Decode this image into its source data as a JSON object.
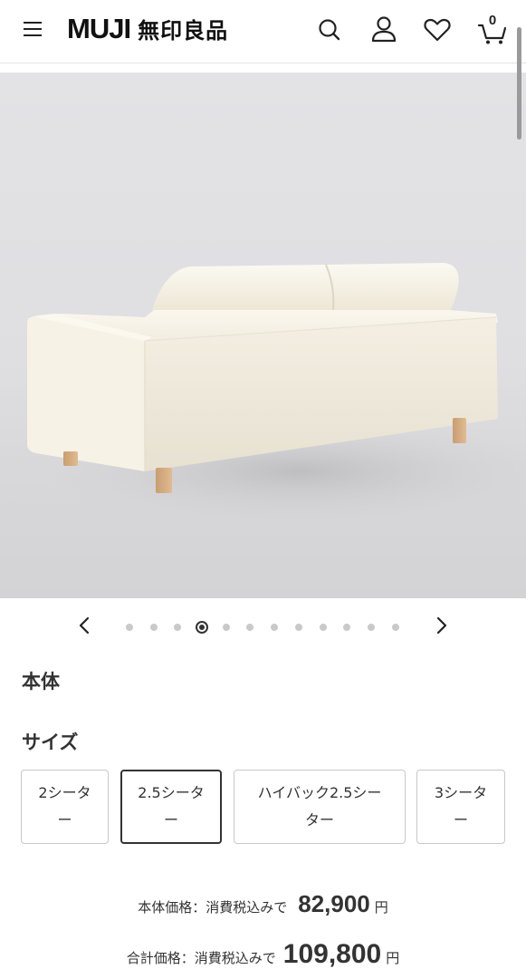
{
  "header": {
    "logo_latin": "MUJI",
    "logo_japanese": "無印良品",
    "cart_count": "0"
  },
  "carousel": {
    "total_images": 12,
    "active_index": 3
  },
  "section_main": {
    "title": "本体"
  },
  "section_size": {
    "title": "サイズ",
    "options": [
      {
        "line1": "2シータ",
        "line2": "ー"
      },
      {
        "line1": "2.5シータ",
        "line2": "ー"
      },
      {
        "line1": "ハイバック2.5シー",
        "line2": "ター"
      },
      {
        "line1": "3シータ",
        "line2": "ー"
      }
    ],
    "selected_index": 1
  },
  "prices": {
    "body_label": "本体価格：消費税込みで",
    "body_value": "82,900",
    "body_unit": "円",
    "total_label": "合計価格：消費税込みで",
    "total_value": "109,800",
    "total_unit": "円"
  },
  "icons": [
    "menu-icon",
    "search-icon",
    "account-icon",
    "heart-icon",
    "cart-icon",
    "chevron-left-icon",
    "chevron-right-icon"
  ],
  "colors": {
    "text": "#222222",
    "border": "#c8c8c8",
    "selected_border": "#333333",
    "sofa": "#f1ecdd"
  }
}
